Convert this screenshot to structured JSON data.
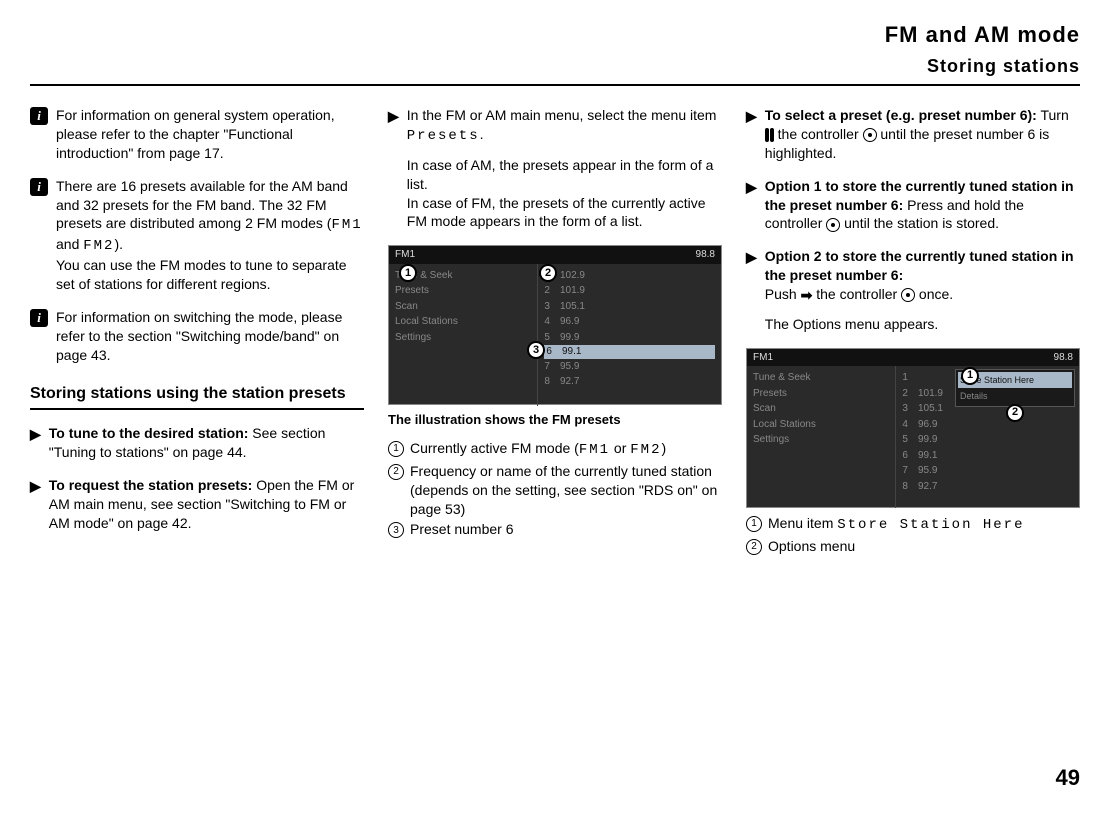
{
  "header": {
    "title": "FM and AM mode",
    "subtitle": "Storing stations"
  },
  "col1": {
    "info1": "For information on general system operation, please refer to the chapter \"Functional introduction\" from page 17.",
    "info2_a": "There are 16 presets available for the AM band and 32 presets for the FM band. The 32 FM presets are distributed among 2 FM modes (",
    "info2_fm1": "FM1",
    "info2_and": " and ",
    "info2_fm2": "FM2",
    "info2_b": ").",
    "info2_c": "You can use the FM modes to tune to separate set of stations for different regions.",
    "info3": "For information on switching the mode, please refer to the section \"Switching mode/band\" on page 43.",
    "heading": "Storing stations using the station presets",
    "step1_bold": "To tune to the desired station:",
    "step1_rest": " See section \"Tuning to stations\" on page 44.",
    "step2_bold": "To request the station presets:",
    "step2_rest": " Open the FM or AM main menu, see section \"Switching to FM or AM mode\" on page 42."
  },
  "col2": {
    "step1_a": "In the FM or AM main menu, select the menu item ",
    "step1_presets": "Presets",
    "step1_b": ".",
    "step1_c": "In case of AM, the presets appear in the form of a list.",
    "step1_d": "In case of FM, the presets of the currently active FM mode appears in the form of a list.",
    "fig_caption": "The illustration shows the FM presets",
    "leg1_a": "Currently active FM mode (",
    "leg1_fm1": "FM1",
    "leg1_or": " or ",
    "leg1_fm2": "FM2",
    "leg1_b": ")",
    "leg2": "Frequency or name of the currently tuned station (depends on the setting, see section \"RDS on\" on page 53)",
    "leg3": "Preset number 6",
    "fig": {
      "header_left": "FM1",
      "header_right": "98.8",
      "menu": [
        "Tune & Seek",
        "Presets",
        "Scan",
        "Local Stations",
        "Settings"
      ],
      "rows": [
        [
          "1",
          "102.9"
        ],
        [
          "2",
          "101.9"
        ],
        [
          "3",
          "105.1"
        ],
        [
          "4",
          "96.9"
        ],
        [
          "5",
          "99.9"
        ],
        [
          "6",
          "99.1"
        ],
        [
          "7",
          "95.9"
        ],
        [
          "8",
          "92.7"
        ]
      ]
    }
  },
  "col3": {
    "step1_bold": "To select a preset (e.g. preset number 6):",
    "step1_a": " Turn ",
    "step1_b": " the controller ",
    "step1_c": " until the preset number 6 is highlighted.",
    "step2_bold": "Option 1 to store the currently tuned station in the preset number 6:",
    "step2_a": " Press and hold the controller ",
    "step2_b": " until the station is stored.",
    "step3_bold": "Option 2 to store the currently tuned station in the preset number 6:",
    "step3_a": "Push ",
    "step3_b": " the controller ",
    "step3_c": " once.",
    "step3_d": "The Options menu appears.",
    "leg1_a": "Menu item ",
    "leg1_item": "Store Station Here",
    "leg2": "Options menu",
    "fig": {
      "header_left": "FM1",
      "header_right": "98.8",
      "menu": [
        "Tune & Seek",
        "Presets",
        "Scan",
        "Local Stations",
        "Settings"
      ],
      "rows": [
        [
          "1",
          ""
        ],
        [
          "2",
          "101.9"
        ],
        [
          "3",
          "105.1"
        ],
        [
          "4",
          "96.9"
        ],
        [
          "5",
          "99.9"
        ],
        [
          "6",
          "99.1"
        ],
        [
          "7",
          "95.9"
        ],
        [
          "8",
          "92.7"
        ]
      ],
      "popup": [
        "Store Station Here",
        "Details"
      ]
    }
  },
  "pagenum": "49"
}
